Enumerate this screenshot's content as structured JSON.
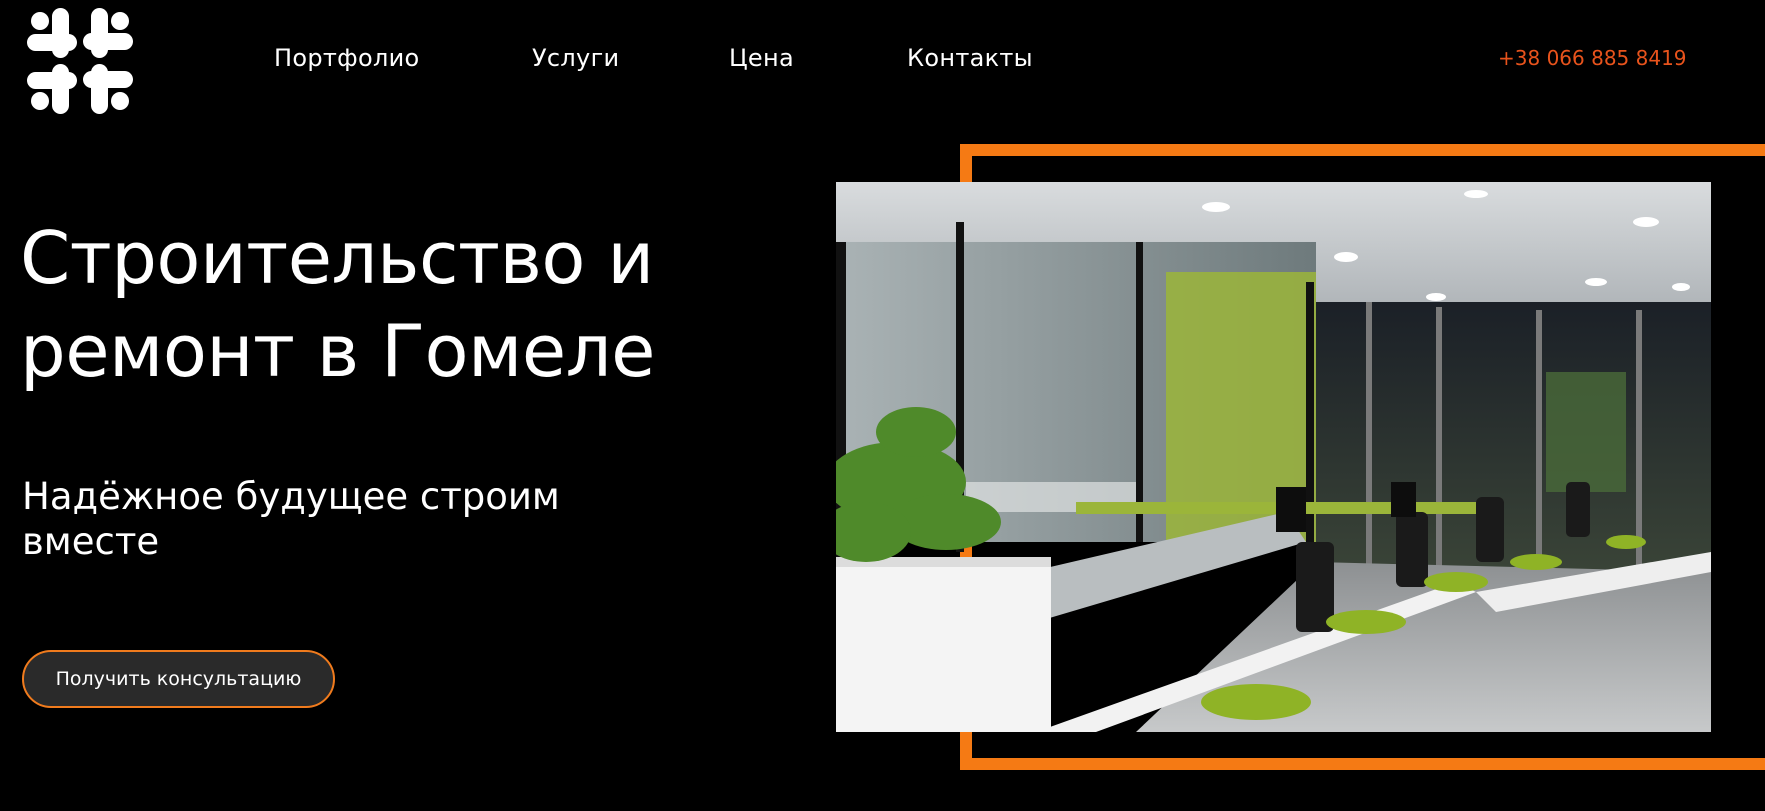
{
  "header": {
    "logo_icon": "slack-style-hash-logo",
    "nav": [
      {
        "label": "Портфолио"
      },
      {
        "label": "Услуги"
      },
      {
        "label": "Цена"
      },
      {
        "label": "Контакты"
      }
    ],
    "phone": "+38 066 885 8419"
  },
  "hero": {
    "title": "Строительство и ремонт в Гомеле",
    "subtitle": "Надёжное будущее строим вместе",
    "cta_label": "Получить консультацию"
  },
  "image": {
    "subject": "office-interior-photo"
  },
  "colors": {
    "background": "#000000",
    "text": "#ffffff",
    "accent": "#f57a14",
    "phone": "#e8531c"
  }
}
